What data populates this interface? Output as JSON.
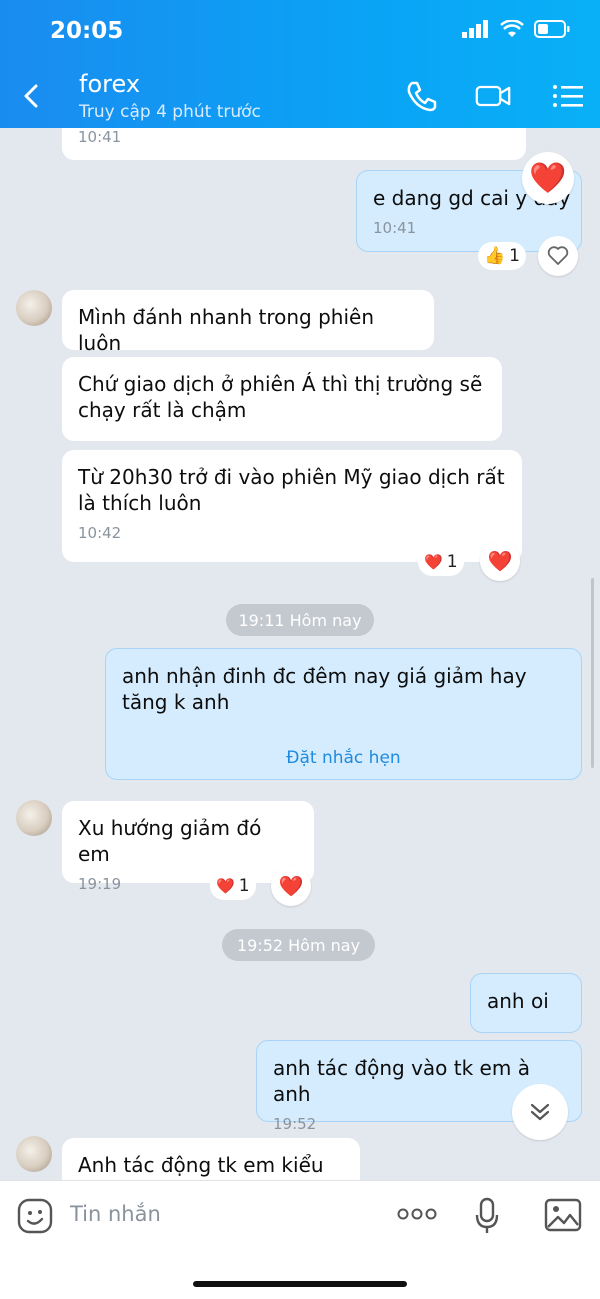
{
  "status_bar": {
    "time": "20:05"
  },
  "header": {
    "title": "forex",
    "subtitle": "Truy cập 4 phút trước"
  },
  "messages": {
    "m0": {
      "time": "10:41"
    },
    "m1": {
      "text": "e dang gd cai y day",
      "time": "10:41",
      "reaction": "👍",
      "reaction_count": "1",
      "big_reaction": "❤️"
    },
    "m2": {
      "text": "Mình đánh nhanh trong phiên luôn"
    },
    "m3": {
      "text": "Chứ giao dịch ở phiên Á thì thị trường sẽ chạy rất là chậm"
    },
    "m4": {
      "text": "Từ 20h30 trở đi vào phiên Mỹ giao dịch rất là thích luôn",
      "time": "10:42",
      "reaction": "❤️",
      "reaction_count": "1"
    },
    "sep1": "19:11 Hôm nay",
    "m5": {
      "text": "anh nhận đinh đc đêm nay giá giảm hay tăng k anh",
      "remind": "Đặt nhắc hẹn"
    },
    "m6": {
      "text": "Xu hướng giảm đó em",
      "time": "19:19",
      "reaction": "❤️",
      "reaction_count": "1"
    },
    "sep2": "19:52 Hôm nay",
    "m7": {
      "text": "anh oi"
    },
    "m8": {
      "text": "anh tác động vào tk em à anh",
      "time": "19:52"
    },
    "m9": {
      "text": "Anh tác động tk em kiểu gì"
    }
  },
  "input": {
    "placeholder": "Tin nhắn"
  },
  "colors": {
    "header": "#1a8cf0",
    "my_bubble": "#d4ecfd",
    "link": "#1f8be0"
  }
}
